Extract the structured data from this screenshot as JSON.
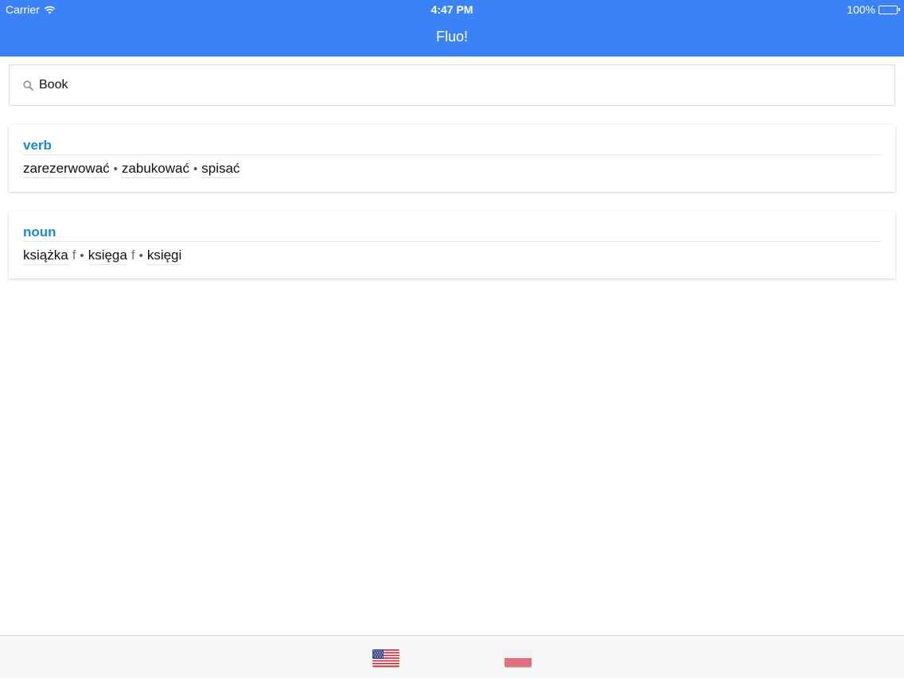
{
  "status_bar": {
    "carrier": "Carrier",
    "time": "4:47 PM",
    "battery": "100%"
  },
  "nav": {
    "title": "Fluo!"
  },
  "search": {
    "value": "Book"
  },
  "results": [
    {
      "pos": "verb",
      "words": [
        {
          "text": "zarezerwować",
          "gender": ""
        },
        {
          "text": "zabukować",
          "gender": ""
        },
        {
          "text": "spisać",
          "gender": ""
        }
      ]
    },
    {
      "pos": "noun",
      "words": [
        {
          "text": "książka",
          "gender": "f"
        },
        {
          "text": "księga",
          "gender": "f"
        },
        {
          "text": "księgi",
          "gender": ""
        }
      ]
    }
  ],
  "separator": "•",
  "tabbar": {
    "items": [
      {
        "icon": "us-flag-icon"
      },
      {
        "icon": "poland-flag-icon"
      }
    ]
  },
  "colors": {
    "accent": "#3b82f6",
    "pos_label": "#1e88d8"
  }
}
